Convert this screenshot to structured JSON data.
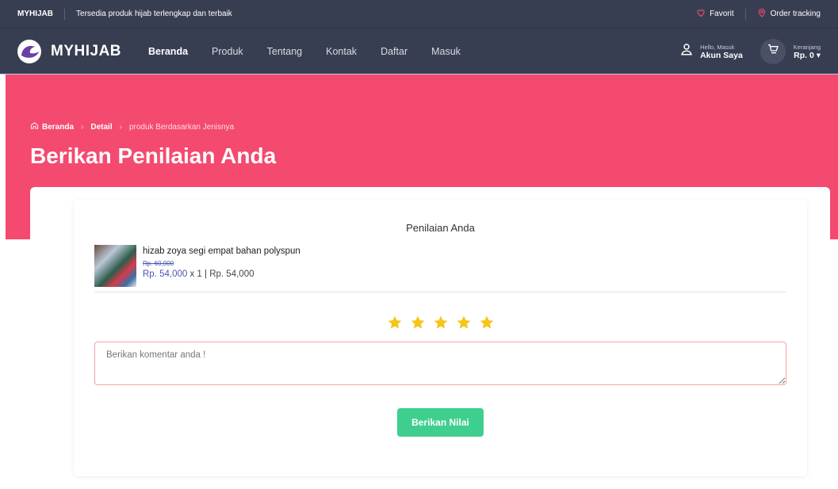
{
  "topbar": {
    "brand": "MYHIJAB",
    "tagline": "Tersedia produk hijab terlengkap dan terbaik",
    "favorite_label": "Favorit",
    "order_tracking_label": "Order tracking"
  },
  "navbar": {
    "logo_text": "MYHIJAB",
    "menu": [
      {
        "label": "Beranda",
        "active": true
      },
      {
        "label": "Produk",
        "active": false
      },
      {
        "label": "Tentang",
        "active": false
      },
      {
        "label": "Kontak",
        "active": false
      },
      {
        "label": "Daftar",
        "active": false
      },
      {
        "label": "Masuk",
        "active": false
      }
    ],
    "account_greeting": "Hello, Masuk",
    "account_label": "Akun Saya",
    "cart_label": "Keranjang",
    "cart_total": "Rp. 0"
  },
  "hero": {
    "breadcrumb": [
      "Beranda",
      "Detail",
      "produk Berdasarkan Jenisnya"
    ],
    "title": "Berikan Penilaian Anda"
  },
  "rating": {
    "heading": "Penilaian Anda",
    "product_name": "hizab zoya segi empat bahan polyspun",
    "old_price": "Rp. 60,000",
    "price": "Rp. 54,000",
    "quantity": "x 1",
    "subtotal": "Rp. 54,000",
    "stars": 5,
    "comment_placeholder": "Berikan komentar anda !",
    "submit_label": "Berikan Nilai"
  },
  "colors": {
    "header_bg": "#383e52",
    "hero_bg": "#f44a70",
    "star": "#f5c518",
    "button": "#3ecf8e",
    "price": "#4a56b0"
  },
  "icons": [
    "logo-mark-icon",
    "heart-icon",
    "location-pin-icon",
    "user-icon",
    "cart-icon",
    "home-icon",
    "star-icon"
  ]
}
